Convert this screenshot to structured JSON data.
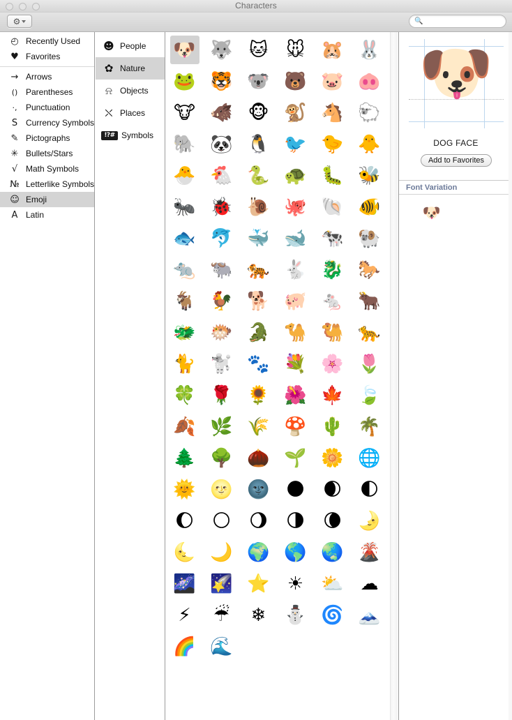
{
  "window": {
    "title": "Characters",
    "traffic_lights": [
      "close",
      "minimize",
      "zoom"
    ]
  },
  "toolbar": {
    "gear_icon": "gear-icon",
    "gear_chevron": "chevron-down-icon",
    "search_icon": "search-icon",
    "search_value": "",
    "search_placeholder": ""
  },
  "categories": {
    "top": [
      {
        "icon": "◴",
        "label": "Recently Used",
        "icon_name": "clock-icon",
        "selected": false
      },
      {
        "icon": "♥",
        "label": "Favorites",
        "icon_name": "heart-icon",
        "selected": false
      }
    ],
    "items": [
      {
        "icon": "→",
        "label": "Arrows",
        "icon_name": "arrow-icon",
        "selected": false
      },
      {
        "icon": "()",
        "label": "Parentheses",
        "icon_name": "parentheses-icon",
        "selected": false
      },
      {
        "icon": "·,",
        "label": "Punctuation",
        "icon_name": "punctuation-icon",
        "selected": false
      },
      {
        "icon": "S",
        "label": "Currency Symbols",
        "icon_name": "currency-icon",
        "selected": false
      },
      {
        "icon": "✎",
        "label": "Pictographs",
        "icon_name": "pictograph-icon",
        "selected": false
      },
      {
        "icon": "✳",
        "label": "Bullets/Stars",
        "icon_name": "asterisk-icon",
        "selected": false
      },
      {
        "icon": "√",
        "label": "Math Symbols",
        "icon_name": "radical-icon",
        "selected": false
      },
      {
        "icon": "№",
        "label": "Letterlike Symbols",
        "icon_name": "numero-icon",
        "selected": false
      },
      {
        "icon": "☺",
        "label": "Emoji",
        "icon_name": "smiley-icon",
        "selected": true
      },
      {
        "icon": "A",
        "label": "Latin",
        "icon_name": "letter-a-icon",
        "selected": false
      }
    ]
  },
  "subcategories": [
    {
      "icon": "☻",
      "label": "People",
      "icon_name": "smiley-face-icon",
      "selected": false
    },
    {
      "icon": "✿",
      "label": "Nature",
      "icon_name": "flower-icon",
      "selected": true
    },
    {
      "icon": "⍾",
      "label": "Objects",
      "icon_name": "bell-icon",
      "selected": false
    },
    {
      "icon": "⛌",
      "label": "Places",
      "icon_name": "car-icon",
      "selected": false
    },
    {
      "icon": "!?#",
      "label": "Symbols",
      "icon_name": "symbols-icon",
      "selected": false
    }
  ],
  "grid": {
    "selected_index": 0,
    "glyphs": [
      {
        "char": "🐶",
        "name": "DOG FACE"
      },
      {
        "char": "🐺",
        "name": "WOLF FACE"
      },
      {
        "char": "🐱",
        "name": "CAT FACE"
      },
      {
        "char": "🐭",
        "name": "MOUSE FACE"
      },
      {
        "char": "🐹",
        "name": "HAMSTER FACE"
      },
      {
        "char": "🐰",
        "name": "RABBIT FACE"
      },
      {
        "char": "🐸",
        "name": "FROG FACE"
      },
      {
        "char": "🐯",
        "name": "TIGER FACE"
      },
      {
        "char": "🐨",
        "name": "KOALA"
      },
      {
        "char": "🐻",
        "name": "BEAR FACE"
      },
      {
        "char": "🐷",
        "name": "PIG FACE"
      },
      {
        "char": "🐽",
        "name": "PIG NOSE"
      },
      {
        "char": "🐮",
        "name": "COW FACE"
      },
      {
        "char": "🐗",
        "name": "BOAR"
      },
      {
        "char": "🐵",
        "name": "MONKEY FACE"
      },
      {
        "char": "🐒",
        "name": "MONKEY"
      },
      {
        "char": "🐴",
        "name": "HORSE FACE"
      },
      {
        "char": "🐑",
        "name": "SHEEP"
      },
      {
        "char": "🐘",
        "name": "ELEPHANT"
      },
      {
        "char": "🐼",
        "name": "PANDA FACE"
      },
      {
        "char": "🐧",
        "name": "PENGUIN"
      },
      {
        "char": "🐦",
        "name": "BIRD"
      },
      {
        "char": "🐤",
        "name": "BABY CHICK"
      },
      {
        "char": "🐥",
        "name": "FRONT-FACING BABY CHICK"
      },
      {
        "char": "🐣",
        "name": "HATCHING CHICK"
      },
      {
        "char": "🐔",
        "name": "CHICKEN"
      },
      {
        "char": "🐍",
        "name": "SNAKE"
      },
      {
        "char": "🐢",
        "name": "TURTLE"
      },
      {
        "char": "🐛",
        "name": "BUG"
      },
      {
        "char": "🐝",
        "name": "HONEYBEE"
      },
      {
        "char": "🐜",
        "name": "ANT"
      },
      {
        "char": "🐞",
        "name": "LADY BEETLE"
      },
      {
        "char": "🐌",
        "name": "SNAIL"
      },
      {
        "char": "🐙",
        "name": "OCTOPUS"
      },
      {
        "char": "🐚",
        "name": "SPIRAL SHELL"
      },
      {
        "char": "🐠",
        "name": "TROPICAL FISH"
      },
      {
        "char": "🐟",
        "name": "FISH"
      },
      {
        "char": "🐬",
        "name": "DOLPHIN"
      },
      {
        "char": "🐳",
        "name": "SPOUTING WHALE"
      },
      {
        "char": "🐋",
        "name": "WHALE"
      },
      {
        "char": "🐄",
        "name": "COW"
      },
      {
        "char": "🐏",
        "name": "RAM"
      },
      {
        "char": "🐀",
        "name": "RAT"
      },
      {
        "char": "🐃",
        "name": "WATER BUFFALO"
      },
      {
        "char": "🐅",
        "name": "TIGER"
      },
      {
        "char": "🐇",
        "name": "RABBIT"
      },
      {
        "char": "🐉",
        "name": "DRAGON"
      },
      {
        "char": "🐎",
        "name": "HORSE"
      },
      {
        "char": "🐐",
        "name": "GOAT"
      },
      {
        "char": "🐓",
        "name": "ROOSTER"
      },
      {
        "char": "🐕",
        "name": "DOG"
      },
      {
        "char": "🐖",
        "name": "PIG"
      },
      {
        "char": "🐁",
        "name": "MOUSE"
      },
      {
        "char": "🐂",
        "name": "OX"
      },
      {
        "char": "🐲",
        "name": "DRAGON FACE"
      },
      {
        "char": "🐡",
        "name": "BLOWFISH"
      },
      {
        "char": "🐊",
        "name": "CROCODILE"
      },
      {
        "char": "🐪",
        "name": "DROMEDARY CAMEL"
      },
      {
        "char": "🐫",
        "name": "BACTRIAN CAMEL"
      },
      {
        "char": "🐆",
        "name": "LEOPARD"
      },
      {
        "char": "🐈",
        "name": "CAT"
      },
      {
        "char": "🐩",
        "name": "POODLE"
      },
      {
        "char": "🐾",
        "name": "PAW PRINTS"
      },
      {
        "char": "💐",
        "name": "BOUQUET"
      },
      {
        "char": "🌸",
        "name": "CHERRY BLOSSOM"
      },
      {
        "char": "🌷",
        "name": "TULIP"
      },
      {
        "char": "🍀",
        "name": "FOUR LEAF CLOVER"
      },
      {
        "char": "🌹",
        "name": "ROSE"
      },
      {
        "char": "🌻",
        "name": "SUNFLOWER"
      },
      {
        "char": "🌺",
        "name": "HIBISCUS"
      },
      {
        "char": "🍁",
        "name": "MAPLE LEAF"
      },
      {
        "char": "🍃",
        "name": "LEAF FLUTTERING IN WIND"
      },
      {
        "char": "🍂",
        "name": "FALLEN LEAF"
      },
      {
        "char": "🌿",
        "name": "HERB"
      },
      {
        "char": "🌾",
        "name": "EAR OF RICE"
      },
      {
        "char": "🍄",
        "name": "MUSHROOM"
      },
      {
        "char": "🌵",
        "name": "CACTUS"
      },
      {
        "char": "🌴",
        "name": "PALM TREE"
      },
      {
        "char": "🌲",
        "name": "EVERGREEN TREE"
      },
      {
        "char": "🌳",
        "name": "DECIDUOUS TREE"
      },
      {
        "char": "🌰",
        "name": "CHESTNUT"
      },
      {
        "char": "🌱",
        "name": "SEEDLING"
      },
      {
        "char": "🌼",
        "name": "BLOSSOM"
      },
      {
        "char": "🌐",
        "name": "GLOBE WITH MERIDIANS"
      },
      {
        "char": "🌞",
        "name": "SUN WITH FACE"
      },
      {
        "char": "🌝",
        "name": "FULL MOON WITH FACE"
      },
      {
        "char": "🌚",
        "name": "NEW MOON WITH FACE"
      },
      {
        "char": "🌑",
        "name": "NEW MOON SYMBOL"
      },
      {
        "char": "🌒",
        "name": "WAXING CRESCENT MOON SYMBOL"
      },
      {
        "char": "🌓",
        "name": "FIRST QUARTER MOON SYMBOL"
      },
      {
        "char": "🌔",
        "name": "WAXING GIBBOUS MOON SYMBOL"
      },
      {
        "char": "🌕",
        "name": "FULL MOON SYMBOL"
      },
      {
        "char": "🌖",
        "name": "WANING GIBBOUS MOON SYMBOL"
      },
      {
        "char": "🌗",
        "name": "LAST QUARTER MOON SYMBOL"
      },
      {
        "char": "🌘",
        "name": "WANING CRESCENT MOON SYMBOL"
      },
      {
        "char": "🌛",
        "name": "FIRST QUARTER MOON WITH FACE"
      },
      {
        "char": "🌜",
        "name": "LAST QUARTER MOON WITH FACE"
      },
      {
        "char": "🌙",
        "name": "CRESCENT MOON"
      },
      {
        "char": "🌍",
        "name": "EARTH GLOBE EUROPE-AFRICA"
      },
      {
        "char": "🌎",
        "name": "EARTH GLOBE AMERICAS"
      },
      {
        "char": "🌏",
        "name": "EARTH GLOBE ASIA-AUSTRALIA"
      },
      {
        "char": "🌋",
        "name": "VOLCANO"
      },
      {
        "char": "🌌",
        "name": "MILKY WAY"
      },
      {
        "char": "🌠",
        "name": "SHOOTING STAR"
      },
      {
        "char": "⭐",
        "name": "WHITE MEDIUM STAR"
      },
      {
        "char": "☀",
        "name": "BLACK SUN WITH RAYS"
      },
      {
        "char": "⛅",
        "name": "SUN BEHIND CLOUD"
      },
      {
        "char": "☁",
        "name": "CLOUD"
      },
      {
        "char": "⚡",
        "name": "HIGH VOLTAGE SIGN"
      },
      {
        "char": "☔",
        "name": "UMBRELLA WITH RAIN DROPS"
      },
      {
        "char": "❄",
        "name": "SNOWFLAKE"
      },
      {
        "char": "⛄",
        "name": "SNOWMAN WITHOUT SNOW"
      },
      {
        "char": "🌀",
        "name": "CYCLONE"
      },
      {
        "char": "🗻",
        "name": "MOUNT FUJI"
      },
      {
        "char": "🌈",
        "name": "RAINBOW"
      },
      {
        "char": "🌊",
        "name": "WATER WAVE"
      }
    ]
  },
  "detail": {
    "preview_char": "🐶",
    "char_name": "DOG FACE",
    "favorites_button": "Add to Favorites",
    "section_title": "Font Variation",
    "variations": [
      {
        "char": "🐶",
        "name": "DOG FACE"
      }
    ]
  }
}
